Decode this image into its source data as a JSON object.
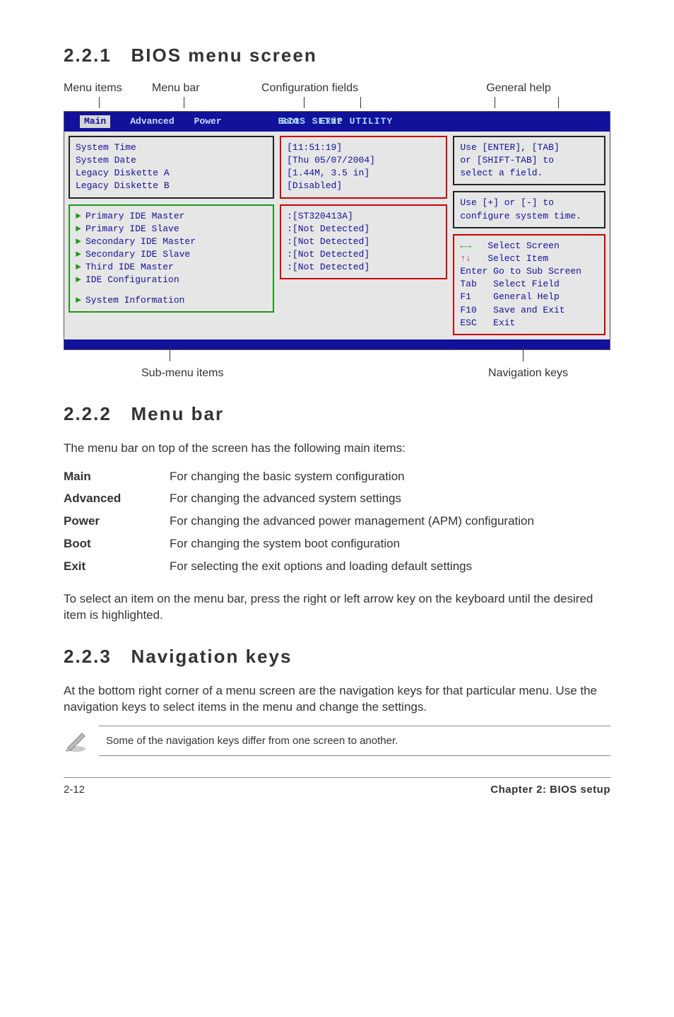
{
  "sections": {
    "s1": {
      "num": "2.2.1",
      "title": "BIOS menu screen"
    },
    "s2": {
      "num": "2.2.2",
      "title": "Menu bar"
    },
    "s3": {
      "num": "2.2.3",
      "title": "Navigation keys"
    }
  },
  "diagram_labels": {
    "menu_items": "Menu items",
    "menu_bar": "Menu bar",
    "config_fields": "Configuration fields",
    "general_help": "General help",
    "sub_menu": "Sub-menu items",
    "nav_keys": "Navigation keys"
  },
  "bios": {
    "title": "BIOS SETUP UTILITY",
    "tabs": [
      "Main",
      "Advanced",
      "Power",
      "Boot",
      "Exit"
    ],
    "left_top": [
      "System Time",
      "System Date",
      "Legacy Diskette A",
      "Legacy Diskette B"
    ],
    "left_mid": [
      "Primary IDE Master",
      "Primary IDE Slave",
      "Secondary IDE Master",
      "Secondary IDE Slave",
      "Third IDE Master",
      "IDE Configuration"
    ],
    "left_bot": [
      "System Information"
    ],
    "mid_top": [
      "[11:51:19]",
      "[Thu 05/07/2004]",
      "[1.44M, 3.5 in]",
      "[Disabled]"
    ],
    "mid_bot": [
      ":[ST320413A]",
      ":[Not Detected]",
      ":[Not Detected]",
      ":[Not Detected]",
      ":[Not Detected]"
    ],
    "help_top": [
      "Use [ENTER], [TAB]",
      "or [SHIFT-TAB] to",
      "select a field."
    ],
    "help_mid": [
      "Use [+] or [-] to",
      "configure system time."
    ],
    "nav": {
      "l1a": "←→",
      "l1b": "   Select Screen",
      "l2a": "↑↓",
      "l2b": "   Select Item",
      "l3": "Enter Go to Sub Screen",
      "l4": "Tab   Select Field",
      "l5": "F1    General Help",
      "l6": "F10   Save and Exit",
      "l7": "ESC   Exit"
    }
  },
  "s2_text": "The menu bar on top of the screen has the following main items:",
  "defs": [
    {
      "term": "Main",
      "desc": "For changing the basic system configuration"
    },
    {
      "term": "Advanced",
      "desc": "For changing the advanced system settings"
    },
    {
      "term": "Power",
      "desc": "For changing the advanced power management (APM) configuration"
    },
    {
      "term": "Boot",
      "desc": "For changing the system boot configuration"
    },
    {
      "term": "Exit",
      "desc": "For selecting the exit options and loading default settings"
    }
  ],
  "s2_para2": "To select an item on the menu bar, press the right or left arrow key on the keyboard until the desired item is highlighted.",
  "s3_para": "At the bottom right corner of a menu screen are the navigation keys for that particular menu. Use the navigation keys to select items in the menu and change the settings.",
  "note": "Some of the navigation keys differ from one screen to another.",
  "footer": {
    "left": "2-12",
    "right": "Chapter 2: BIOS setup"
  }
}
